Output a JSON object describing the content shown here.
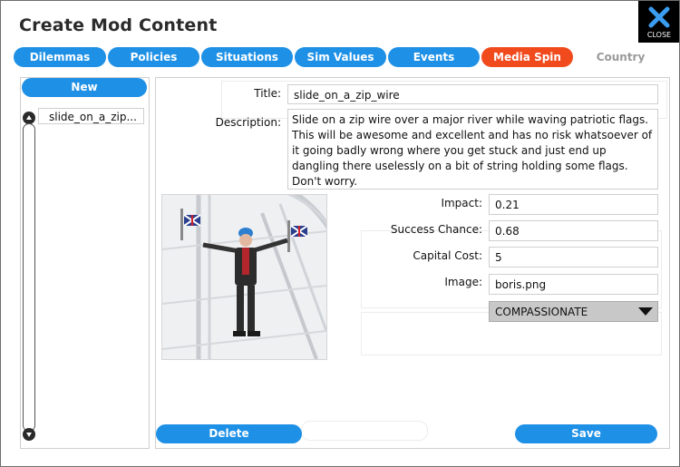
{
  "window": {
    "title": "Create Mod Content"
  },
  "close": {
    "label": "CLOSE"
  },
  "tabs": [
    {
      "label": "Dilemmas",
      "state": "normal"
    },
    {
      "label": "Policies",
      "state": "normal"
    },
    {
      "label": "Situations",
      "state": "normal"
    },
    {
      "label": "Sim Values",
      "state": "normal"
    },
    {
      "label": "Events",
      "state": "normal"
    },
    {
      "label": "Media Spin",
      "state": "active"
    },
    {
      "label": "Country",
      "state": "disabled"
    }
  ],
  "sidebar": {
    "new_label": "New",
    "items": [
      {
        "label": "slide_on_a_zip..."
      }
    ]
  },
  "form": {
    "title_label": "Title:",
    "title_value": "slide_on_a_zip_wire",
    "description_label": "Description:",
    "description_value": "Slide on a zip wire over a major river while waving patriotic flags. This will be awesome and excellent and has no risk whatsoever of it going badly wrong where you get stuck and just end up dangling there uselessly on a bit of string holding some flags. Don't worry.",
    "impact_label": "Impact:",
    "impact_value": "0.21",
    "success_label": "Success Chance:",
    "success_value": "0.68",
    "capital_label": "Capital Cost:",
    "capital_value": "5",
    "image_label": "Image:",
    "image_value": "boris.png",
    "dropdown_value": "COMPASSIONATE"
  },
  "buttons": {
    "delete_label": "Delete",
    "save_label": "Save"
  },
  "colors": {
    "primary": "#1e90e6",
    "active_tab": "#f04a1d",
    "close_bg": "#000000"
  }
}
